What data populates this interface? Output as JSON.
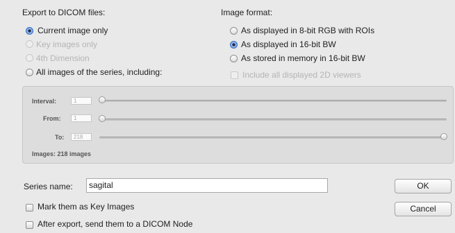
{
  "export_section": {
    "title": "Export to DICOM files:",
    "options": [
      {
        "label": "Current image only",
        "selected": true,
        "enabled": true
      },
      {
        "label": "Key images only",
        "selected": false,
        "enabled": false
      },
      {
        "label": "4th Dimension",
        "selected": false,
        "enabled": false
      },
      {
        "label": "All images of the series, including:",
        "selected": false,
        "enabled": true
      }
    ]
  },
  "format_section": {
    "title": "Image format:",
    "options": [
      {
        "label": "As displayed in 8-bit RGB with ROIs",
        "selected": false
      },
      {
        "label": "As displayed in 16-bit BW",
        "selected": true
      },
      {
        "label": "As stored in memory in 16-bit BW",
        "selected": false
      }
    ],
    "include_2d_label": "Include all displayed 2D viewers"
  },
  "range": {
    "interval_label": "Interval:",
    "interval_value": "1",
    "from_label": "From:",
    "from_value": "1",
    "to_label": "To:",
    "to_value": "218",
    "images_text": "Images: 218 images"
  },
  "series": {
    "label": "Series name:",
    "value": "sagital"
  },
  "checkboxes": {
    "key_images": "Mark them as Key Images",
    "send_dicom": "After export, send them to a DICOM Node"
  },
  "buttons": {
    "ok": "OK",
    "cancel": "Cancel"
  }
}
